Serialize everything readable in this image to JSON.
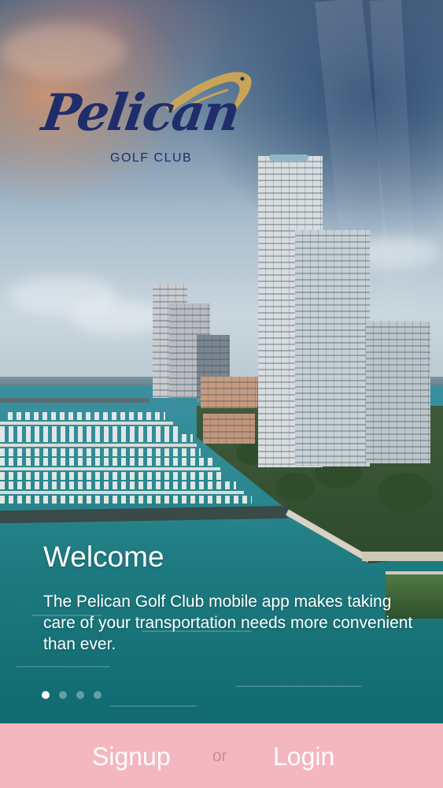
{
  "logo": {
    "script_text": "Pelican",
    "subtitle": "GOLF CLUB",
    "icon": "pelican-icon",
    "colors": {
      "navy": "#1f2d6b",
      "gold": "#c7a458"
    }
  },
  "welcome": {
    "title": "Welcome",
    "body": "The Pelican Golf Club mobile app makes taking care of your transportation needs more convenient than ever."
  },
  "pager": {
    "page_count": 4,
    "active_index": 0
  },
  "auth_bar": {
    "signup_label": "Signup",
    "separator": "or",
    "login_label": "Login",
    "background": "#f4b6bf"
  }
}
